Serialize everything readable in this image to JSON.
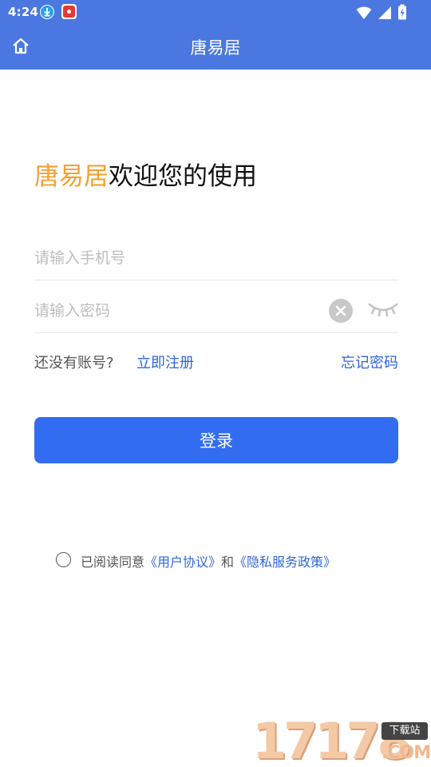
{
  "status_bar": {
    "time": "4:24",
    "icons": [
      "download-icon",
      "app-notification-icon",
      "wifi-icon",
      "signal-icon",
      "battery-icon"
    ]
  },
  "app_bar": {
    "title": "唐易居",
    "home_icon": "home-icon"
  },
  "welcome": {
    "brand": "唐易居",
    "text": "欢迎您的使用"
  },
  "form": {
    "phone_placeholder": "请输入手机号",
    "phone_value": "",
    "password_placeholder": "请输入密码",
    "password_value": "",
    "clear_icon": "clear-icon",
    "visibility_icon": "eye-closed-icon"
  },
  "links": {
    "no_account": "还没有账号?",
    "register": "立即注册",
    "forgot_password": "忘记密码"
  },
  "login_button": "登录",
  "agreement": {
    "prefix": "已阅读同意",
    "user_agreement": "《用户协议》",
    "and": "和",
    "privacy_policy": "《隐私服务政策》"
  },
  "watermark": {
    "number": "17178",
    "badge": "下载站",
    "suffix": ".COM"
  },
  "colors": {
    "primary": "#4a78e0",
    "button": "#326cf0",
    "link": "#2f66d8",
    "brand": "#f5a030"
  }
}
